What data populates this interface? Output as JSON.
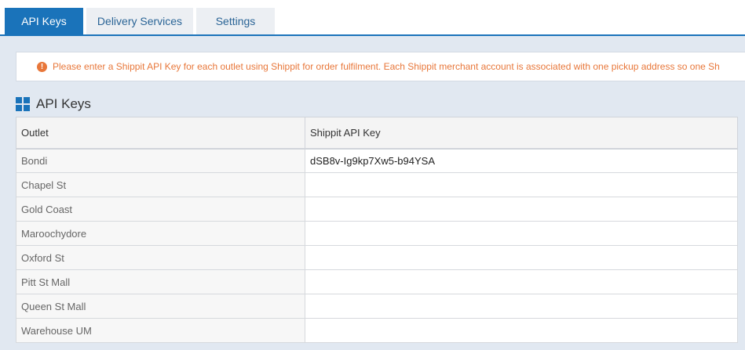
{
  "tabs": [
    {
      "label": "API Keys",
      "active": true
    },
    {
      "label": "Delivery Services",
      "active": false
    },
    {
      "label": "Settings",
      "active": false
    }
  ],
  "alert": {
    "icon": "exclamation-icon",
    "text": "Please enter a Shippit API Key for each outlet using Shippit for order fulfilment. Each Shippit merchant account is associated with one pickup address so one Sh"
  },
  "section": {
    "icon": "grid-icon",
    "title": "API Keys"
  },
  "table": {
    "headers": [
      "Outlet",
      "Shippit API Key"
    ],
    "rows": [
      {
        "outlet": "Bondi",
        "key": "dSB8v-Ig9kp7Xw5-b94YSA"
      },
      {
        "outlet": "Chapel St",
        "key": ""
      },
      {
        "outlet": "Gold Coast",
        "key": ""
      },
      {
        "outlet": "Maroochydore",
        "key": ""
      },
      {
        "outlet": "Oxford St",
        "key": ""
      },
      {
        "outlet": "Pitt St Mall",
        "key": ""
      },
      {
        "outlet": "Queen St Mall",
        "key": ""
      },
      {
        "outlet": "Warehouse UM",
        "key": ""
      }
    ]
  },
  "colors": {
    "accent": "#1a73ba",
    "alert": "#e8773a",
    "background": "#e1e8f1"
  }
}
